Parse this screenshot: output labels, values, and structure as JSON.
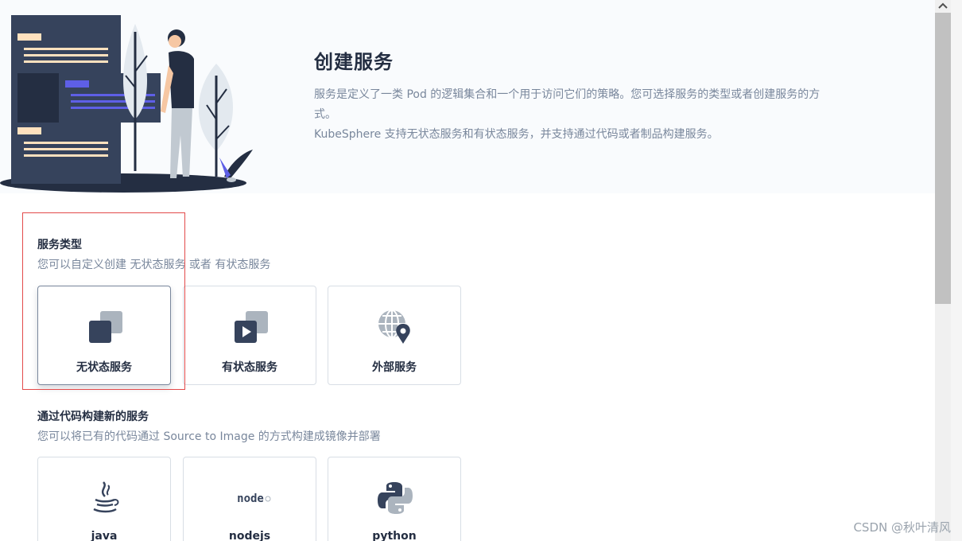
{
  "header": {
    "title": "创建服务",
    "desc_line1": "服务是定义了一类 Pod 的逻辑集合和一个用于访问它们的策略。您可选择服务的类型或者创建服务的方",
    "desc_line2": "式。",
    "desc_line3": "KubeSphere 支持无状态服务和有状态服务，并支持通过代码或者制品构建服务。"
  },
  "service_types": {
    "title": "服务类型",
    "desc": "您可以自定义创建 无状态服务 或者 有状态服务",
    "cards": [
      {
        "label": "无状态服务",
        "icon": "stateless-service-icon",
        "selected": true
      },
      {
        "label": "有状态服务",
        "icon": "stateful-service-icon",
        "selected": false
      },
      {
        "label": "外部服务",
        "icon": "external-service-icon",
        "selected": false
      }
    ]
  },
  "code_build": {
    "title": "通过代码构建新的服务",
    "desc": "您可以将已有的代码通过 Source to Image 的方式构建成镜像并部署",
    "cards": [
      {
        "label": "java",
        "icon": "java-icon"
      },
      {
        "label": "nodejs",
        "icon": "nodejs-icon"
      },
      {
        "label": "python",
        "icon": "python-icon"
      }
    ]
  },
  "watermark": "CSDN @秋叶清风",
  "colors": {
    "header_bg": "#f9fbfd",
    "dark": "#242e42",
    "muted": "#79879c",
    "accent": "#5e5fe6",
    "highlight": "#e34a4a"
  }
}
